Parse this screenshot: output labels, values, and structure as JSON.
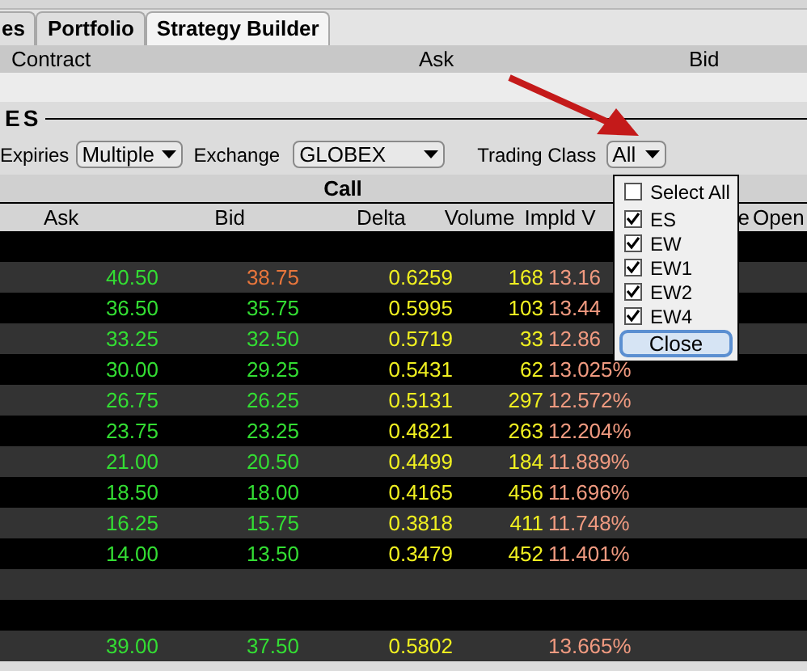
{
  "tabs": [
    {
      "label": "es",
      "selected": false
    },
    {
      "label": "Portfolio",
      "selected": false
    },
    {
      "label": "Strategy Builder",
      "selected": true
    }
  ],
  "quote_header": {
    "columns": [
      "Contract",
      "Ask",
      "Bid"
    ]
  },
  "section": {
    "title": "ES"
  },
  "filters": [
    {
      "label": "Expiries",
      "value": "Multiple"
    },
    {
      "label": "Exchange",
      "value": "GLOBEX"
    },
    {
      "label": "Trading Class",
      "value": "All"
    }
  ],
  "chain": {
    "side_title": "Call",
    "columns": [
      "Ask",
      "Bid",
      "Delta",
      "Volume",
      "Impld V",
      "e",
      "Open"
    ],
    "rows": [
      {
        "kind": "blank"
      },
      {
        "kind": "data",
        "ask": "40.50",
        "bid": "38.75",
        "bid_down": true,
        "delta": "0.6259",
        "volume": "168",
        "impl_vol": "13.16"
      },
      {
        "kind": "data",
        "ask": "36.50",
        "bid": "35.75",
        "bid_down": false,
        "delta": "0.5995",
        "volume": "103",
        "impl_vol": "13.44"
      },
      {
        "kind": "data",
        "ask": "33.25",
        "bid": "32.50",
        "bid_down": false,
        "delta": "0.5719",
        "volume": "33",
        "impl_vol": "12.86"
      },
      {
        "kind": "data",
        "ask": "30.00",
        "bid": "29.25",
        "bid_down": false,
        "delta": "0.5431",
        "volume": "62",
        "impl_vol": "13.025%"
      },
      {
        "kind": "data",
        "ask": "26.75",
        "bid": "26.25",
        "bid_down": false,
        "delta": "0.5131",
        "volume": "297",
        "impl_vol": "12.572%"
      },
      {
        "kind": "data",
        "ask": "23.75",
        "bid": "23.25",
        "bid_down": false,
        "delta": "0.4821",
        "volume": "263",
        "impl_vol": "12.204%"
      },
      {
        "kind": "data",
        "ask": "21.00",
        "bid": "20.50",
        "bid_down": false,
        "delta": "0.4499",
        "volume": "184",
        "impl_vol": "11.889%"
      },
      {
        "kind": "data",
        "ask": "18.50",
        "bid": "18.00",
        "bid_down": false,
        "delta": "0.4165",
        "volume": "456",
        "impl_vol": "11.696%"
      },
      {
        "kind": "data",
        "ask": "16.25",
        "bid": "15.75",
        "bid_down": false,
        "delta": "0.3818",
        "volume": "411",
        "impl_vol": "11.748%"
      },
      {
        "kind": "data",
        "ask": "14.00",
        "bid": "13.50",
        "bid_down": false,
        "delta": "0.3479",
        "volume": "452",
        "impl_vol": "11.401%"
      },
      {
        "kind": "blank"
      },
      {
        "kind": "blank"
      },
      {
        "kind": "data",
        "ask": "39.00",
        "bid": "37.50",
        "bid_down": false,
        "delta": "0.5802",
        "impl_vol": "13.665%"
      }
    ]
  },
  "trading_class_popup": {
    "items": [
      {
        "label": "Select All",
        "checked": false
      },
      {
        "label": "ES",
        "checked": true
      },
      {
        "label": "EW",
        "checked": true
      },
      {
        "label": "EW1",
        "checked": true
      },
      {
        "label": "EW2",
        "checked": true
      },
      {
        "label": "EW4",
        "checked": true
      }
    ],
    "close_button": "Close"
  }
}
